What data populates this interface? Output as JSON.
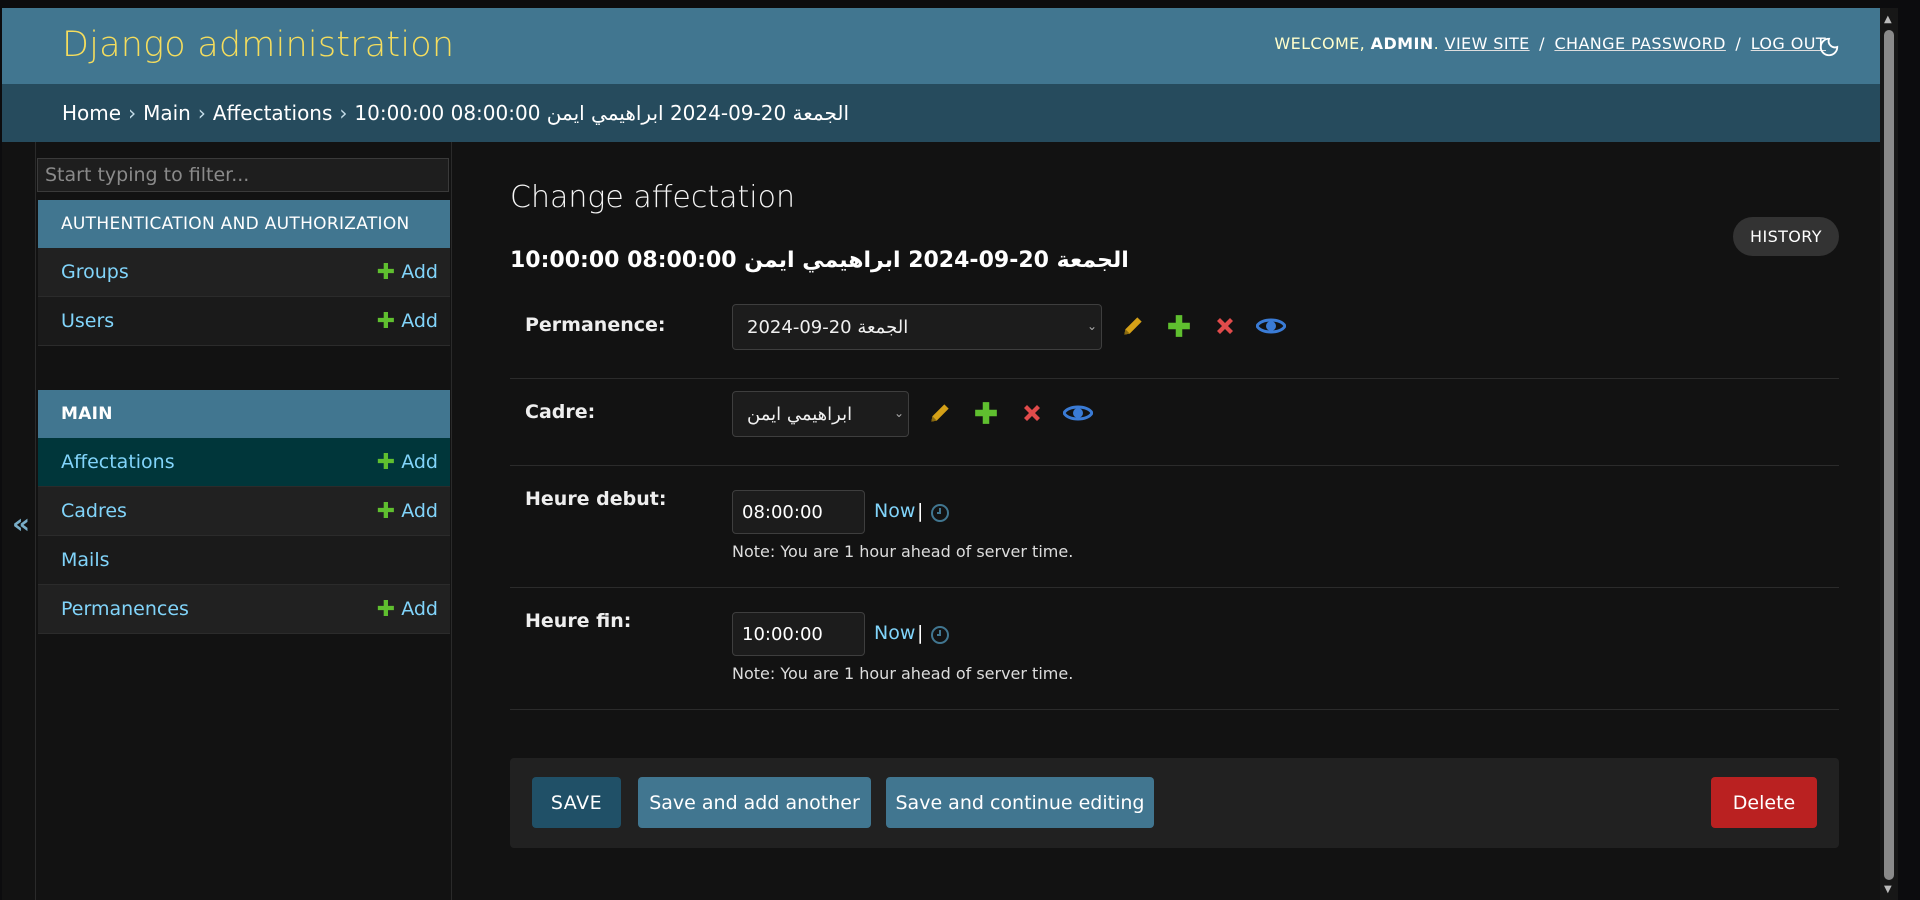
{
  "header": {
    "brand": "Django administration",
    "welcome": "WELCOME,",
    "username": "ADMIN",
    "period": ".",
    "links": [
      "VIEW SITE",
      "CHANGE PASSWORD",
      "LOG OUT"
    ],
    "separator": "/"
  },
  "breadcrumbs": {
    "items": [
      "Home",
      "Main",
      "Affectations"
    ],
    "current": "الجمعة 20-09-2024 ابراهيمي ايمن 08:00:00 10:00:00",
    "separator": "›"
  },
  "sidebar": {
    "filter_placeholder": "Start typing to filter...",
    "toggle_glyph": "«",
    "add_label": "Add",
    "modules": [
      {
        "caption": "AUTHENTICATION AND AUTHORIZATION",
        "items": [
          "Groups",
          "Users"
        ]
      },
      {
        "caption": "MAIN",
        "items": [
          "Affectations",
          "Cadres",
          "Mails",
          "Permanences"
        ]
      }
    ]
  },
  "content": {
    "page_title": "Change affectation",
    "history_label": "HISTORY",
    "object_title": "الجمعة 20-09-2024 ابراهيمي ايمن 08:00:00 10:00:00",
    "fields": {
      "permanence": {
        "label": "Permanence:",
        "value": "الجمعة 20-09-2024"
      },
      "cadre": {
        "label": "Cadre:",
        "value": "ابراهيمي ايمن"
      },
      "heure_debut": {
        "label": "Heure debut:",
        "value": "08:00:00",
        "now": "Now",
        "pipe": "|",
        "note": "Note: You are 1 hour ahead of server time."
      },
      "heure_fin": {
        "label": "Heure fin:",
        "value": "10:00:00",
        "now": "Now",
        "pipe": "|",
        "note": "Note: You are 1 hour ahead of server time."
      }
    },
    "buttons": {
      "save": "SAVE",
      "save_add": "Save and add another",
      "save_continue": "Save and continue editing",
      "delete": "Delete"
    }
  },
  "colors": {
    "header": "#417690",
    "breadcrumbs": "#264b5d",
    "brand": "#f5dd5d",
    "link": "#81d4fa",
    "add_plus": "#5fbf2f",
    "delete": "#ba2121",
    "edit_icon": "#d4a017",
    "remove_icon": "#e04b4b",
    "view_icon": "#3a7bd5"
  }
}
